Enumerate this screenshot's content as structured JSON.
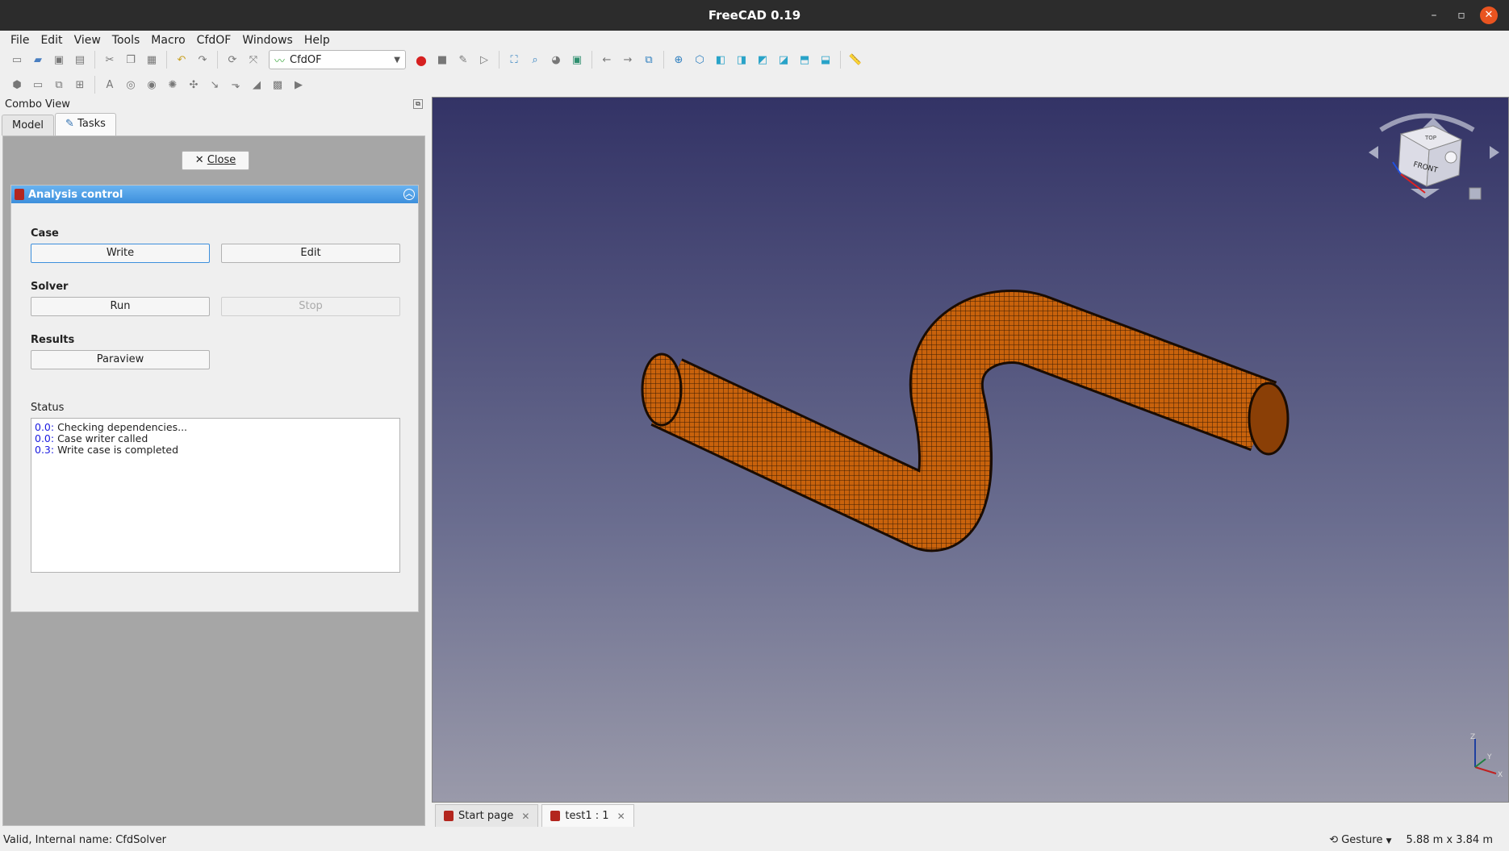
{
  "window": {
    "title": "FreeCAD 0.19"
  },
  "menu": [
    "File",
    "Edit",
    "View",
    "Tools",
    "Macro",
    "CfdOF",
    "Windows",
    "Help"
  ],
  "toolbar": {
    "workbench": "CfdOF"
  },
  "combo": {
    "title": "Combo View",
    "tabs": [
      "Model",
      "Tasks"
    ],
    "close_label": "Close"
  },
  "analysis": {
    "title": "Analysis control",
    "case_label": "Case",
    "write_label": "Write",
    "edit_label": "Edit",
    "solver_label": "Solver",
    "run_label": "Run",
    "stop_label": "Stop",
    "results_label": "Results",
    "paraview_label": "Paraview",
    "status_label": "Status",
    "status_lines": [
      {
        "time": "0.0:",
        "text": "Checking dependencies..."
      },
      {
        "time": "0.0:",
        "text": "Case writer called"
      },
      {
        "time": "0.3:",
        "text": "Write case is completed"
      }
    ]
  },
  "navcube": {
    "front": "FRONT",
    "top": "TOP"
  },
  "axes": {
    "x": "X",
    "y": "Y",
    "z": "Z"
  },
  "doc_tabs": [
    "Start page",
    "test1 : 1"
  ],
  "statusbar": {
    "message": "Valid, Internal name: CfdSolver",
    "nav_style": "Gesture",
    "dimensions": "5.88 m x 3.84 m"
  },
  "colors": {
    "mesh": "#c8620c",
    "accent": "#3d8fdc"
  }
}
